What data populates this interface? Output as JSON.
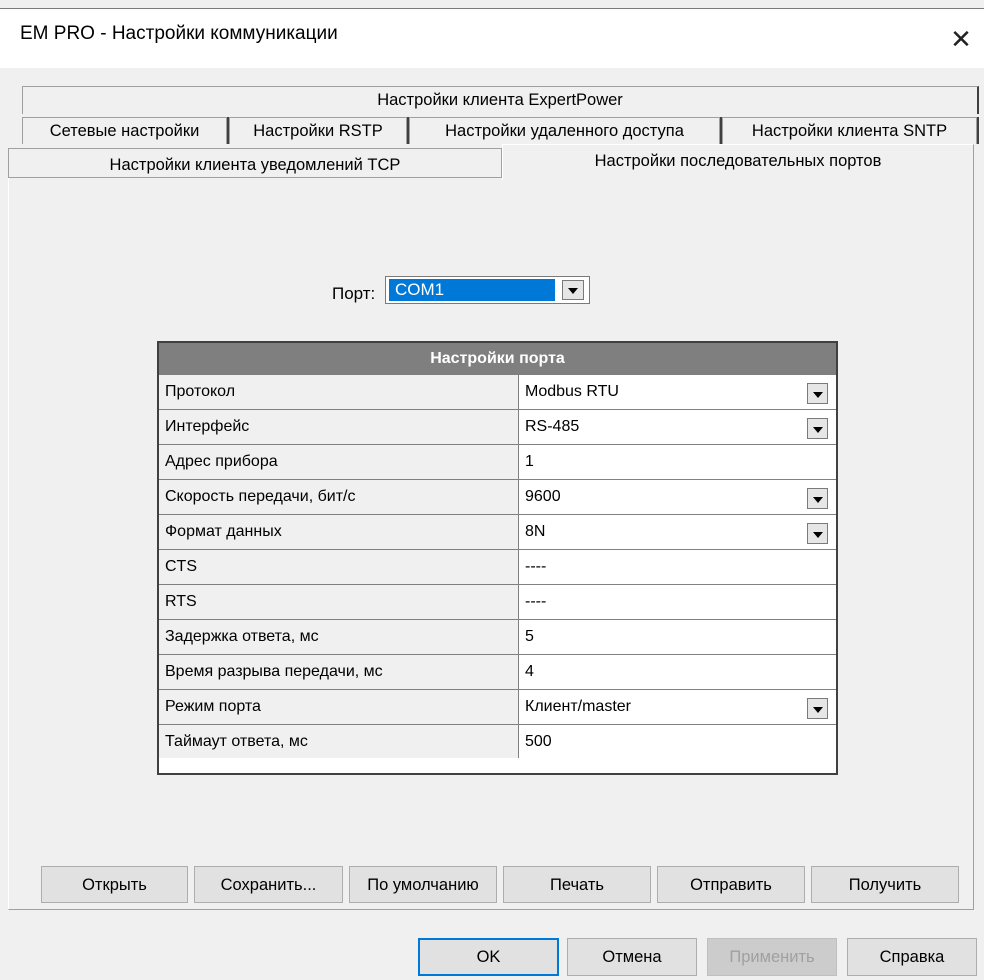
{
  "window": {
    "title": "EM PRO - Настройки коммуникации",
    "close_glyph": "✕"
  },
  "tabs": {
    "row1": [
      "Настройки клиента ExpertPower"
    ],
    "row2": [
      "Сетевые настройки",
      "Настройки RSTP",
      "Настройки удаленного доступа",
      "Настройки клиента SNTP"
    ],
    "row3": [
      "Настройки клиента уведомлений TCP",
      "Настройки последовательных портов"
    ],
    "selected": "Настройки последовательных портов"
  },
  "port": {
    "label": "Порт:",
    "value": "COM1"
  },
  "grid": {
    "header": "Настройки порта",
    "rows": [
      {
        "name": "Протокол",
        "value": "Modbus RTU",
        "dropdown": true
      },
      {
        "name": "Интерфейс",
        "value": "RS-485",
        "dropdown": true
      },
      {
        "name": "Адрес прибора",
        "value": "1",
        "dropdown": false
      },
      {
        "name": "Скорость передачи, бит/с",
        "value": "9600",
        "dropdown": true
      },
      {
        "name": "Формат данных",
        "value": "8N",
        "dropdown": true
      },
      {
        "name": "CTS",
        "value": "----",
        "dropdown": false
      },
      {
        "name": "RTS",
        "value": "----",
        "dropdown": false
      },
      {
        "name": "Задержка ответа, мс",
        "value": "5",
        "dropdown": false
      },
      {
        "name": "Время разрыва передачи, мс",
        "value": "4",
        "dropdown": false
      },
      {
        "name": "Режим порта",
        "value": "Клиент/master",
        "dropdown": true
      },
      {
        "name": "Таймаут ответа, мс",
        "value": "500",
        "dropdown": false
      }
    ]
  },
  "actions": {
    "open": "Открыть",
    "save": "Сохранить...",
    "defaults": "По умолчанию",
    "print": "Печать",
    "send": "Отправить",
    "receive": "Получить"
  },
  "dialog": {
    "ok": "OK",
    "cancel": "Отмена",
    "apply": "Применить",
    "help": "Справка"
  },
  "colors": {
    "selection": "#0078d7",
    "grid_header": "#7f7f7f",
    "background": "#f0f0f0"
  }
}
